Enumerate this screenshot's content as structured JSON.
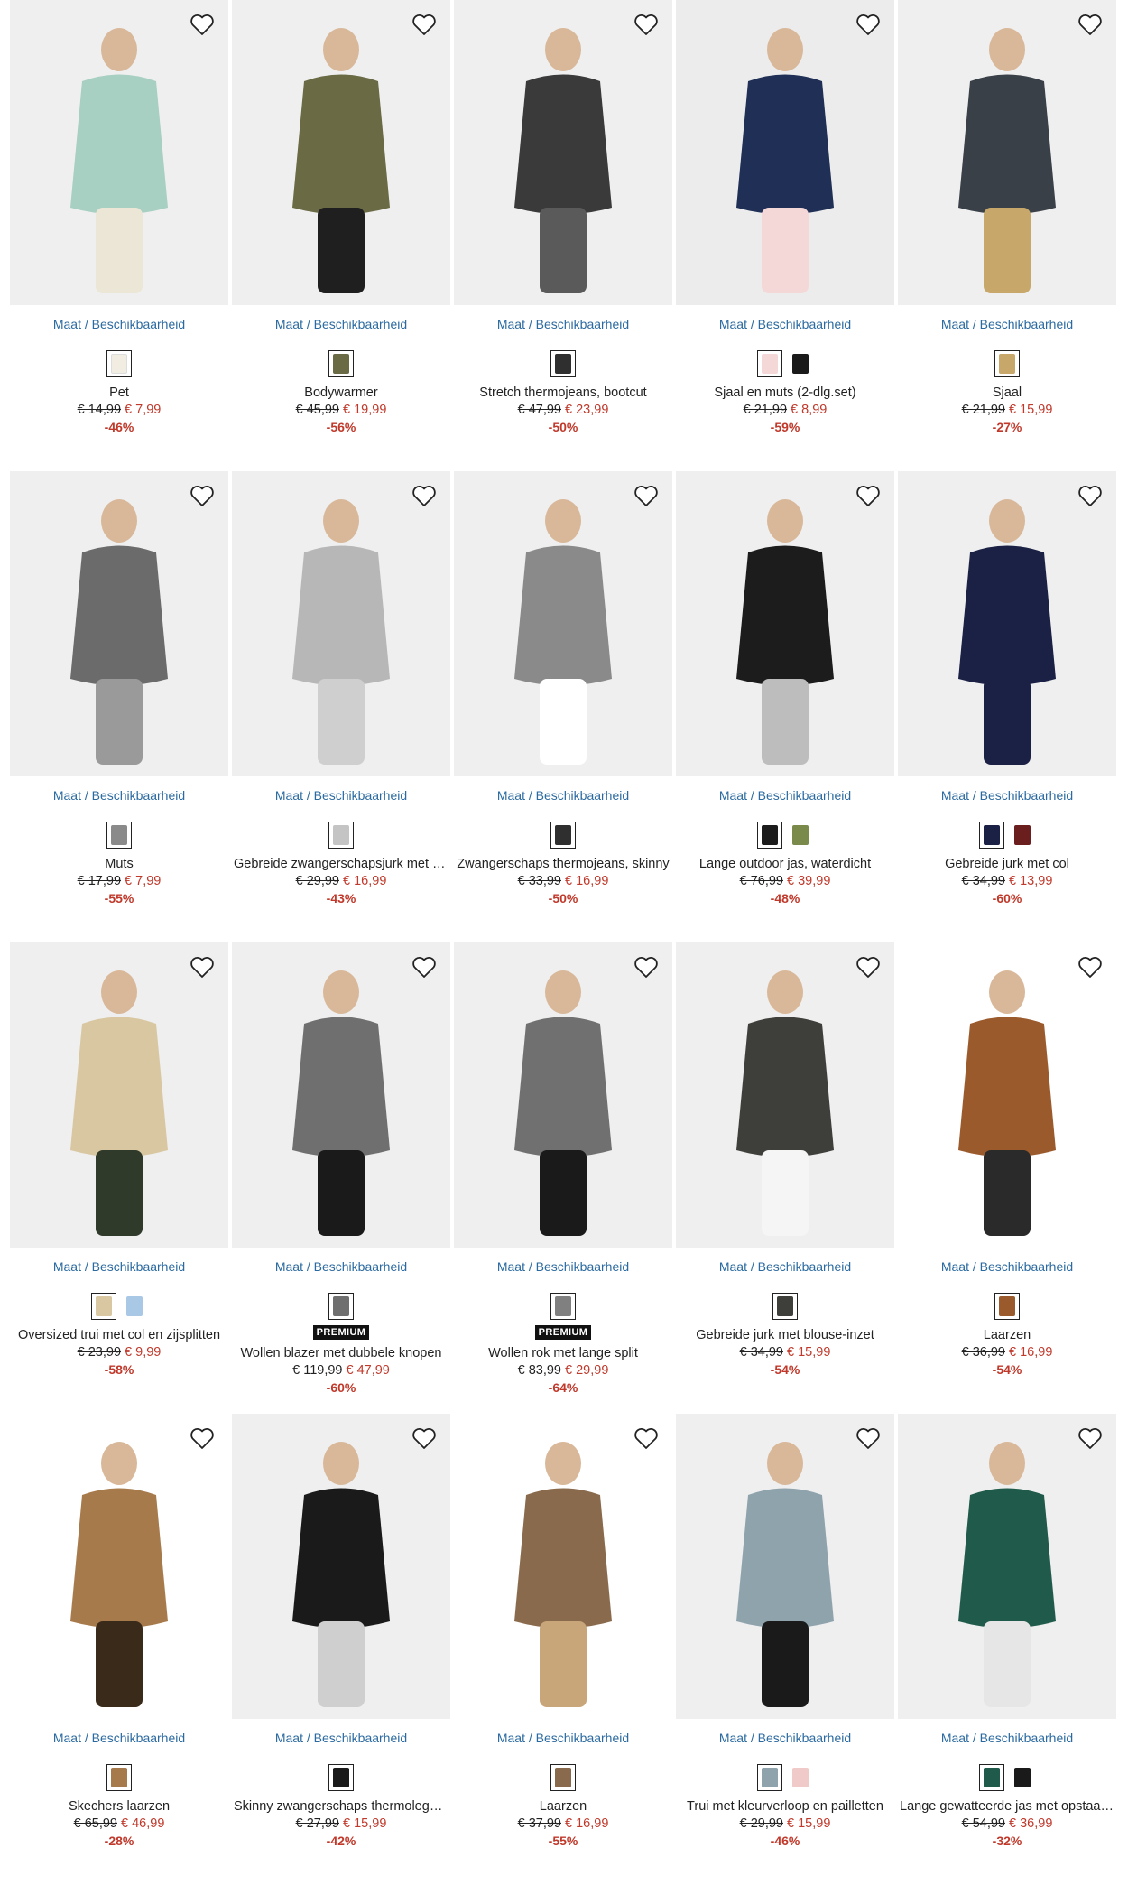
{
  "labels": {
    "size_link": "Maat / Beschikbaarheid"
  },
  "colors": {
    "link": "#2b6aa0",
    "sale": "#c0392b"
  },
  "products": [
    {
      "name": "Pet",
      "old": "€ 14,99",
      "new": "€ 7,99",
      "disc": "-46%",
      "badge": "",
      "bg": "#efefef",
      "garment": "#a7cfc2",
      "accent": "#ece6d6",
      "swatches": [
        "#f1ede3"
      ]
    },
    {
      "name": "Bodywarmer",
      "old": "€ 45,99",
      "new": "€ 19,99",
      "disc": "-56%",
      "badge": "",
      "bg": "#efefef",
      "garment": "#6a6a45",
      "accent": "#1f1f1f",
      "swatches": [
        "#6a6a45"
      ]
    },
    {
      "name": "Stretch thermojeans, bootcut",
      "old": "€ 47,99",
      "new": "€ 23,99",
      "disc": "-50%",
      "badge": "",
      "bg": "#efefef",
      "garment": "#3a3a3a",
      "accent": "#5a5a5a",
      "swatches": [
        "#2f2f2f"
      ]
    },
    {
      "name": "Sjaal en muts (2-dlg.set)",
      "old": "€ 21,99",
      "new": "€ 8,99",
      "disc": "-59%",
      "badge": "",
      "bg": "#ececec",
      "garment": "#1f2f55",
      "accent": "#f4d8d8",
      "swatches": [
        "#f4d8d8",
        "#1a1a1a"
      ]
    },
    {
      "name": "Sjaal",
      "old": "€ 21,99",
      "new": "€ 15,99",
      "disc": "-27%",
      "badge": "",
      "bg": "#efefef",
      "garment": "#3a4048",
      "accent": "#c8a86a",
      "swatches": [
        "#c8a86a"
      ]
    },
    {
      "name": "Muts",
      "old": "€ 17,99",
      "new": "€ 7,99",
      "disc": "-55%",
      "badge": "",
      "bg": "#efefef",
      "garment": "#6b6b6b",
      "accent": "#9a9a9a",
      "swatches": [
        "#8a8a8a"
      ]
    },
    {
      "name": "Gebreide zwangerschapsjurk met kabelpatroon",
      "old": "€ 29,99",
      "new": "€ 16,99",
      "disc": "-43%",
      "badge": "",
      "bg": "#efefef",
      "garment": "#b7b7b7",
      "accent": "#cfcfcf",
      "swatches": [
        "#c4c4c4"
      ]
    },
    {
      "name": "Zwangerschaps thermojeans, skinny",
      "old": "€ 33,99",
      "new": "€ 16,99",
      "disc": "-50%",
      "badge": "",
      "bg": "#efefef",
      "garment": "#8a8a8a",
      "accent": "#ffffff",
      "swatches": [
        "#2f2f2f"
      ]
    },
    {
      "name": "Lange outdoor jas, waterdicht",
      "old": "€ 76,99",
      "new": "€ 39,99",
      "disc": "-48%",
      "badge": "",
      "bg": "#efefef",
      "garment": "#1c1c1c",
      "accent": "#bdbdbd",
      "swatches": [
        "#1c1c1c",
        "#7a8a4a"
      ]
    },
    {
      "name": "Gebreide jurk met col",
      "old": "€ 34,99",
      "new": "€ 13,99",
      "disc": "-60%",
      "badge": "",
      "bg": "#efefef",
      "garment": "#1b2145",
      "accent": "#1b2145",
      "swatches": [
        "#1b2145",
        "#6a1e1e"
      ]
    },
    {
      "name": "Oversized trui met col en zijsplitten",
      "old": "€ 23,99",
      "new": "€ 9,99",
      "disc": "-58%",
      "badge": "",
      "bg": "#efefef",
      "garment": "#d8c7a0",
      "accent": "#2f3a2a",
      "swatches": [
        "#d8c7a0",
        "#a9c8e6"
      ]
    },
    {
      "name": "Wollen blazer met dubbele knopen",
      "old": "€ 119,99",
      "new": "€ 47,99",
      "disc": "-60%",
      "badge": "PREMIUM",
      "bg": "#efefef",
      "garment": "#6f6f6f",
      "accent": "#1a1a1a",
      "swatches": [
        "#6f6f6f"
      ]
    },
    {
      "name": "Wollen rok met lange split",
      "old": "€ 83,99",
      "new": "€ 29,99",
      "disc": "-64%",
      "badge": "PREMIUM",
      "bg": "#efefef",
      "garment": "#707070",
      "accent": "#1a1a1a",
      "swatches": [
        "#808080"
      ]
    },
    {
      "name": "Gebreide jurk met blouse-inzet",
      "old": "€ 34,99",
      "new": "€ 15,99",
      "disc": "-54%",
      "badge": "",
      "bg": "#efefef",
      "garment": "#3e3f3a",
      "accent": "#f5f5f5",
      "swatches": [
        "#3e3f3a"
      ]
    },
    {
      "name": "Laarzen",
      "old": "€ 36,99",
      "new": "€ 16,99",
      "disc": "-54%",
      "badge": "",
      "bg": "#ffffff",
      "garment": "#9a5a2c",
      "accent": "#2a2a2a",
      "swatches": [
        "#9a5a2c"
      ]
    },
    {
      "name": "Skechers laarzen",
      "old": "€ 65,99",
      "new": "€ 46,99",
      "disc": "-28%",
      "badge": "",
      "bg": "#ffffff",
      "garment": "#a77a4c",
      "accent": "#3a2a1a",
      "swatches": [
        "#a77a4c"
      ]
    },
    {
      "name": "Skinny zwangerschaps thermoleggings",
      "old": "€ 27,99",
      "new": "€ 15,99",
      "disc": "-42%",
      "badge": "",
      "bg": "#efefef",
      "garment": "#1a1a1a",
      "accent": "#cfcfcf",
      "swatches": [
        "#1a1a1a"
      ]
    },
    {
      "name": "Laarzen",
      "old": "€ 37,99",
      "new": "€ 16,99",
      "disc": "-55%",
      "badge": "",
      "bg": "#ffffff",
      "garment": "#8a6a4c",
      "accent": "#c9a57a",
      "swatches": [
        "#8a6a4c"
      ]
    },
    {
      "name": "Trui met kleurverloop en pailletten",
      "old": "€ 29,99",
      "new": "€ 15,99",
      "disc": "-46%",
      "badge": "",
      "bg": "#efefef",
      "garment": "#8fa3ad",
      "accent": "#1a1a1a",
      "swatches": [
        "#8fa3ad",
        "#f0c9c9"
      ]
    },
    {
      "name": "Lange gewatteerde jas met opstaande kraag",
      "old": "€ 54,99",
      "new": "€ 36,99",
      "disc": "-32%",
      "badge": "",
      "bg": "#efefef",
      "garment": "#1f5a4a",
      "accent": "#e6e6e6",
      "swatches": [
        "#1f5a4a",
        "#1a1a1a"
      ]
    }
  ]
}
